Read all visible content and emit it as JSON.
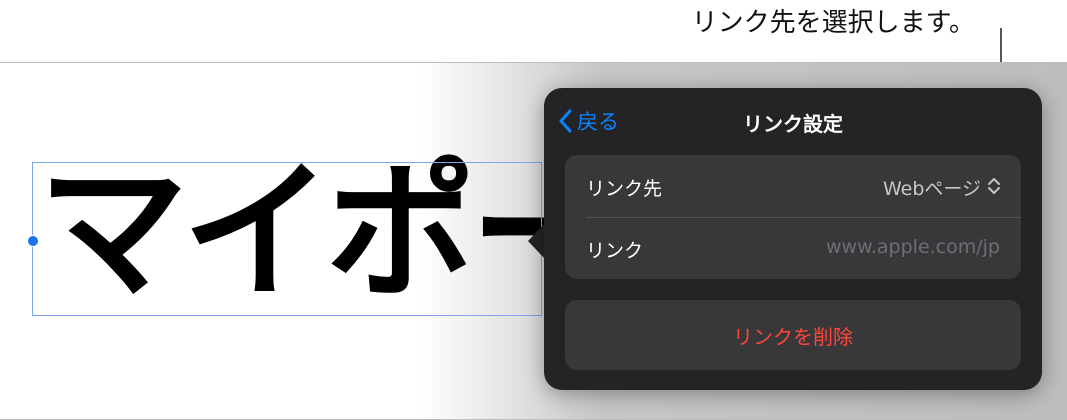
{
  "callout": {
    "text": "リンク先を選択します。"
  },
  "canvas": {
    "text": "マイポート"
  },
  "popover": {
    "back_label": "戻る",
    "title": "リンク設定",
    "rows": [
      {
        "label": "リンク先",
        "value": "Webページ"
      },
      {
        "label": "リンク",
        "value": "www.apple.com/jp"
      }
    ],
    "delete_label": "リンクを削除"
  },
  "colors": {
    "accent": "#0a84ff",
    "destructive": "#ff453a",
    "popover_bg": "#242426",
    "group_bg": "#38383a"
  }
}
